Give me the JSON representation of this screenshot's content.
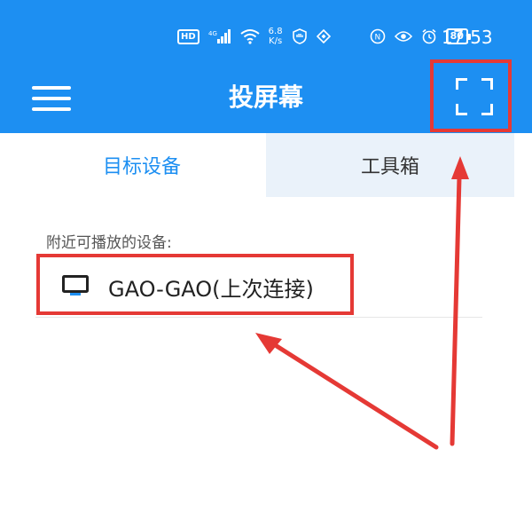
{
  "status_bar": {
    "hd_badge": "HD",
    "signal_label": "4G",
    "net_speed_value": "6.8",
    "net_speed_unit": "K/s",
    "battery": "80",
    "time": "17:53"
  },
  "app_bar": {
    "title": "投屏幕",
    "menu_icon": "hamburger-menu-icon",
    "scan_icon": "scan-frame-icon"
  },
  "tabs": [
    {
      "label": "目标设备",
      "active": true
    },
    {
      "label": "工具箱",
      "active": false
    }
  ],
  "devices_section": {
    "label": "附近可播放的设备:",
    "devices": [
      {
        "name": "GAO-GAO(上次连接)",
        "icon": "monitor-icon"
      }
    ]
  },
  "colors": {
    "primary": "#1d8ff2",
    "annotation": "#e53935",
    "inactive_tab_bg": "#eaf2fa"
  }
}
